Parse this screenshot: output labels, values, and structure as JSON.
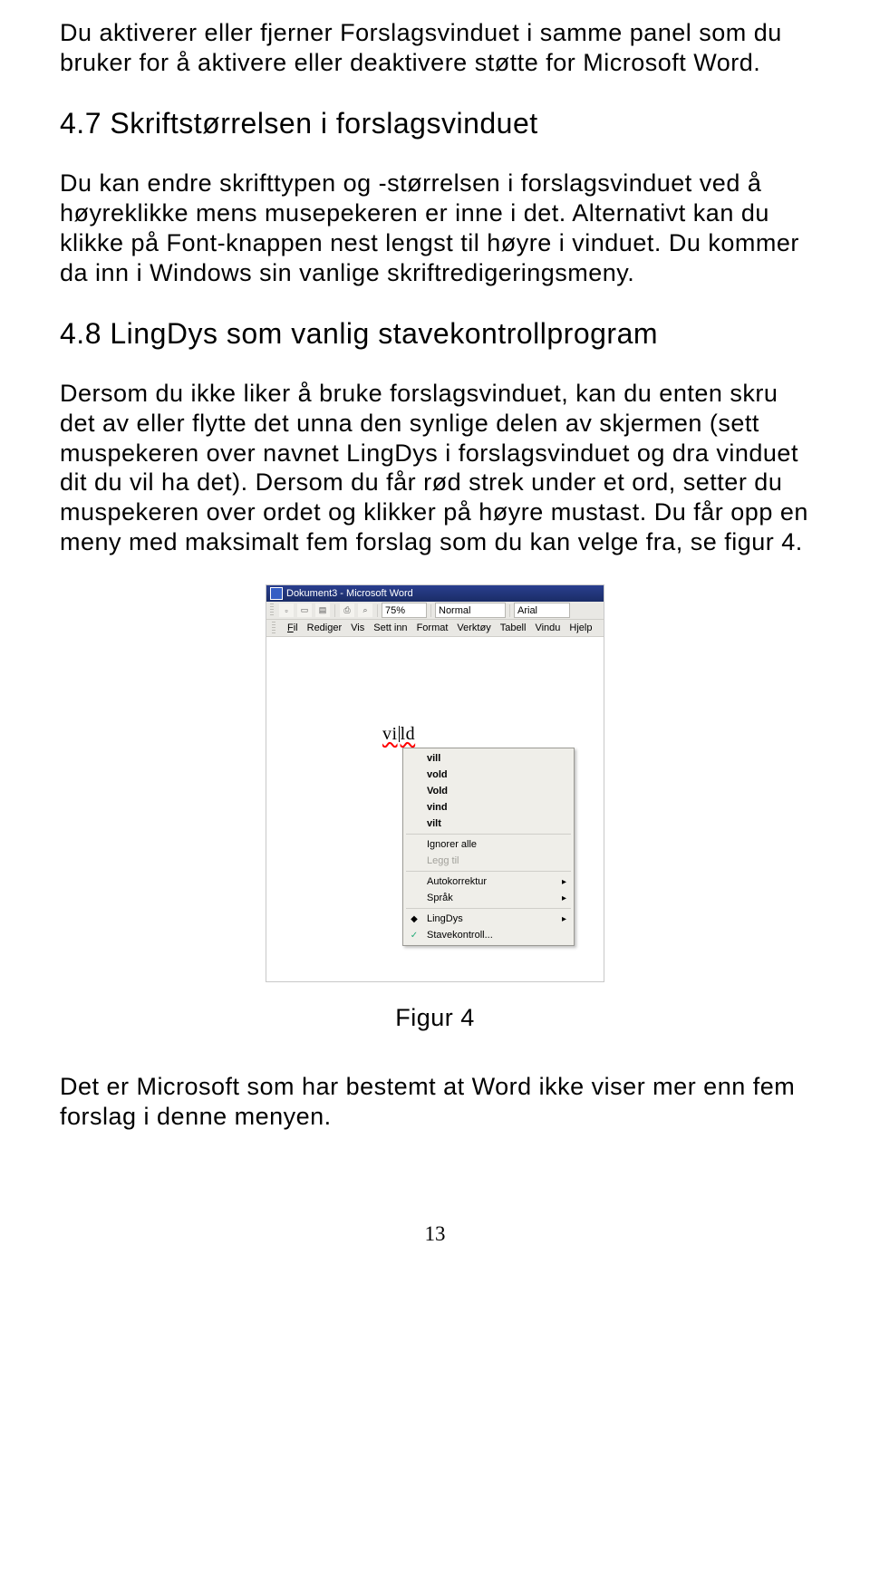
{
  "paragraphs": {
    "intro": "Du aktiverer eller fjerner Forslagsvinduet i samme panel som du bruker for å aktivere eller deaktivere støtte for Microsoft Word.",
    "sec47_body": "Du kan endre skrifttypen og -størrelsen i forslagsvinduet ved å høyreklikke mens musepekeren er inne i det. Alternativt kan du klikke på Font-knappen nest lengst til høyre i vinduet. Du kommer da inn i Windows sin vanlige skriftredigeringsmeny.",
    "sec48_body": "Dersom du ikke liker å bruke forslagsvinduet, kan du enten skru det av eller flytte det unna den synlige delen av skjermen (sett muspekeren over navnet LingDys i forslagsvinduet og dra vinduet dit du vil ha det). Dersom du får rød strek under et ord, setter du muspekeren over ordet og klikker på høyre mustast. Du får opp en meny med maksimalt fem forslag som du kan velge fra, se figur 4.",
    "outro": "Det er Microsoft som har bestemt at Word ikke viser mer enn fem forslag i denne menyen."
  },
  "headings": {
    "sec47": "4.7 Skriftstørrelsen i forslagsvinduet",
    "sec48": "4.8 LingDys som vanlig stavekontrollprogram"
  },
  "figure": {
    "caption": "Figur 4",
    "window_title": "Dokument3 - Microsoft Word",
    "zoom_value": "75%",
    "style_value": "Normal",
    "font_value": "Arial",
    "menu": {
      "fil": "Fil",
      "rediger": "Rediger",
      "vis": "Vis",
      "settinn": "Sett inn",
      "format": "Format",
      "verktoy": "Verktøy",
      "tabell": "Tabell",
      "vindu": "Vindu",
      "hjelp": "Hjelp"
    },
    "typed_pre": "vi",
    "typed_post": "ld",
    "context_menu": {
      "s1": "vill",
      "s2": "vold",
      "s3": "Vold",
      "s4": "vind",
      "s5": "vilt",
      "ignore_all": "Ignorer alle",
      "add": "Legg til",
      "autocorrect": "Autokorrektur",
      "language": "Språk",
      "lingdys": "LingDys",
      "spellcheck": "Stavekontroll..."
    }
  },
  "page_number": "13"
}
